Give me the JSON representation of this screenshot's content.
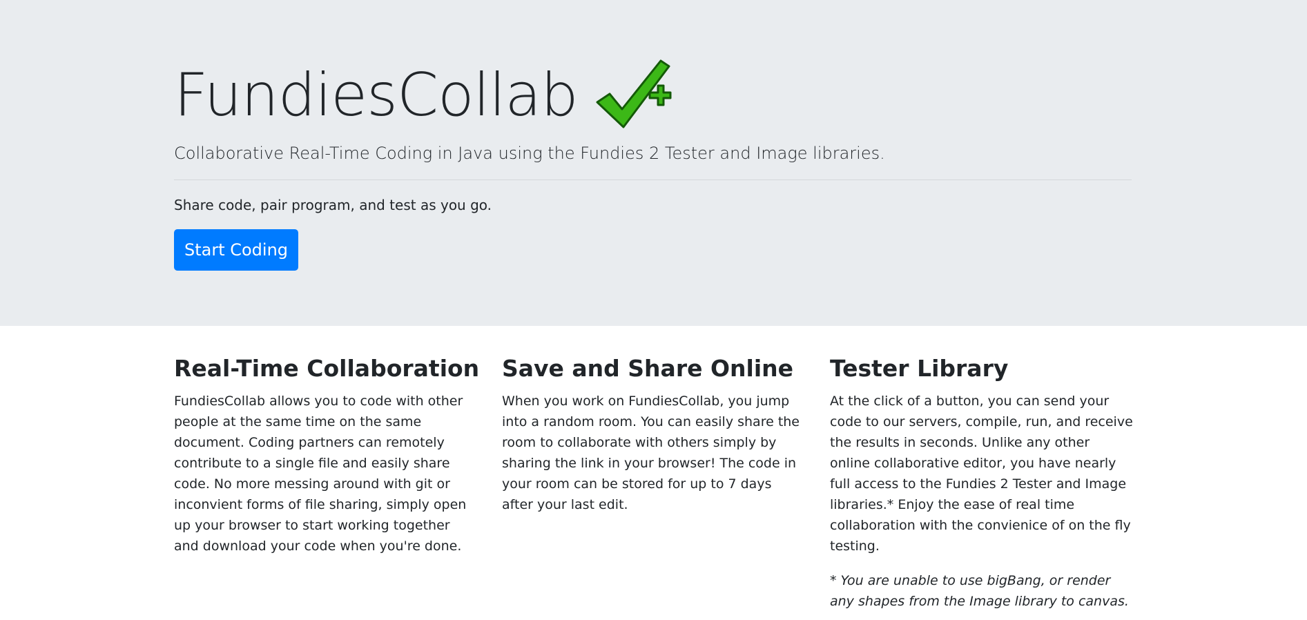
{
  "hero": {
    "title": "FundiesCollab",
    "logo_icon": "green-checkmark-plus-icon",
    "lead": "Collaborative Real-Time Coding in Java using the Fundies 2 Tester and Image libraries.",
    "tagline": "Share code, pair program, and test as you go.",
    "cta_label": "Start Coding"
  },
  "features": [
    {
      "heading": "Real-Time Collaboration",
      "body": "FundiesCollab allows you to code with other people at the same time on the same document. Coding partners can remotely contribute to a single file and easily share code. No more messing around with git or inconvient forms of file sharing, simply open up your browser to start working together and download your code when you're done."
    },
    {
      "heading": "Save and Share Online",
      "body": "When you work on FundiesCollab, you jump into a random room. You can easily share the room to collaborate with others simply by sharing the link in your browser! The code in your room can be stored for up to 7 days after your last edit."
    },
    {
      "heading": "Tester Library",
      "body": "At the click of a button, you can send your code to our servers, compile, run, and receive the results in seconds. Unlike any other online collaborative editor, you have nearly full access to the Fundies 2 Tester and Image libraries.* Enjoy the ease of real time collaboration with the convienice of on the fly testing.",
      "note": "* You are unable to use bigBang, or render any shapes from the Image library to canvas."
    }
  ],
  "colors": {
    "hero_bg": "#e9ecef",
    "primary": "#007bff",
    "check_green": "#3cb817",
    "text": "#212529"
  }
}
